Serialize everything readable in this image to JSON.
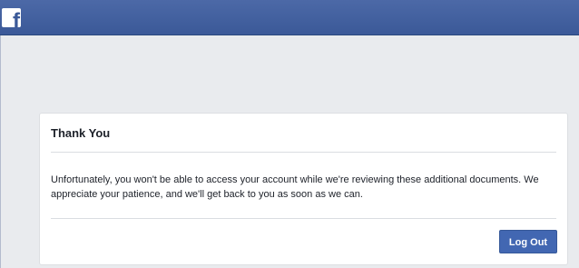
{
  "header": {
    "logo_icon": "facebook-logo-icon",
    "logo_glyph": "f",
    "brand_color": "#3b5998"
  },
  "card": {
    "title": "Thank You",
    "message": "Unfortunately, you won't be able to access your account while we're reviewing these additional documents. We appreciate your patience, and we'll get back to you as soon as we can.",
    "logout_label": "Log Out",
    "button_color": "#4267b2"
  }
}
